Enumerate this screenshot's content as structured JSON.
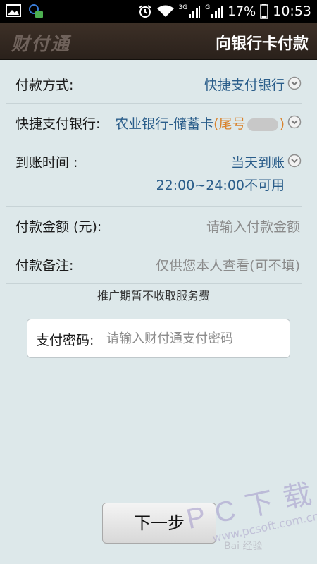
{
  "status_bar": {
    "signal_3g": "3G",
    "signal_g": "G",
    "battery": "17%",
    "time": "10:53"
  },
  "header": {
    "logo": "财付通",
    "title": "向银行卡付款"
  },
  "form": {
    "payment_method": {
      "label": "付款方式:",
      "value": "快捷支付银行"
    },
    "quick_bank": {
      "label": "快捷支付银行:",
      "value": "农业银行-储蓄卡",
      "tail_open": "(尾号",
      "tail_close": ")"
    },
    "arrival_time": {
      "label": "到账时间 :",
      "value": "当天到账",
      "note": "22:00~24:00不可用"
    },
    "amount": {
      "label": "付款金额 (元):",
      "placeholder": "请输入付款金额"
    },
    "remark": {
      "label": "付款备注:",
      "placeholder": "仅供您本人查看(可不填)"
    }
  },
  "promo_note": "推广期暂不收取服务费",
  "password": {
    "label": "支付密码:",
    "placeholder": "请输入财付通支付密码"
  },
  "next_button": "下一步",
  "watermark": {
    "line1": "P C 下 载 网",
    "line2": "www.pcsoft.com.cn",
    "line3": "Bai 经验"
  }
}
